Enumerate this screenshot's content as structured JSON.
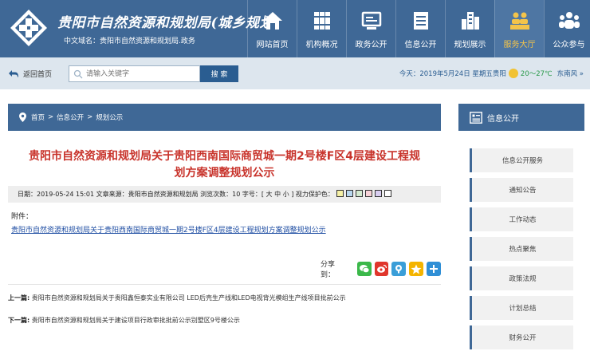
{
  "header": {
    "site_name": "贵阳市自然资源和规划局(城乡规划)",
    "domain_text": "中文域名：贵阳市自然资源和规划局.政务",
    "nav": [
      {
        "label": "网站首页",
        "icon": "home-icon",
        "active": false
      },
      {
        "label": "机构概况",
        "icon": "books-icon",
        "active": false
      },
      {
        "label": "政务公开",
        "icon": "monitor-icon",
        "active": false
      },
      {
        "label": "信息公开",
        "icon": "document-icon",
        "active": false
      },
      {
        "label": "规划展示",
        "icon": "buildings-icon",
        "active": false
      },
      {
        "label": "服务大厅",
        "icon": "people-group-icon",
        "active": true
      },
      {
        "label": "公众参与",
        "icon": "users-icon",
        "active": false
      }
    ],
    "active_color": "#f4c44a",
    "brand_color": "#3f6896"
  },
  "topbar": {
    "home_label": "返回首页",
    "search_placeholder": "请输入关键字",
    "search_button": "搜 索",
    "date_text": "今天：2019年5月24日 星期五贵阳",
    "temperature": "20～27℃",
    "wind": "东南风 »"
  },
  "breadcrumb": {
    "items": [
      "首页",
      "信息公开",
      "规划公示"
    ],
    "separator": ">"
  },
  "article": {
    "title_line1": "贵阳市自然资源和规划局关于贵阳西南国际商贸城一期2号楼F区4层建设工程规",
    "title_line2": "划方案调整规划公示",
    "meta": "日期：2019-05-24 15:01  文章来源：贵阳市自然资源和规划局  浏览次数：10  字号：[ 大 中 小 ]  视力保护色：",
    "eye_colors": [
      "#f6f1a6",
      "#b9d7ee",
      "#d4ead0",
      "#f8d2d8",
      "#d9cef1",
      "#ffffff"
    ],
    "attach_label": "附件：",
    "attach_link": "贵阳市自然资源和规划局关于贵阳西南国际商贸城一期2号楼F区4层建设工程规划方案调整规划公示",
    "share_label": "分享到：",
    "share_icons": [
      "wechat-icon",
      "weibo-icon",
      "tencent-icon",
      "qzone-icon",
      "more-share-icon"
    ],
    "prev_label": "上一篇:",
    "prev_text": "贵阳市自然资源和规划局关于贵阳鑫恒泰实业有限公司 LED后壳生产线和LED电视背光模组生产线项目批前公示",
    "next_label": "下一篇:",
    "next_text": "贵阳市自然资源和规划局关于建设项目行政审批批前公示别墅区9号楼公示"
  },
  "sidebar": {
    "title": "信息公开",
    "items": [
      "信息公开服务",
      "通知公告",
      "工作动态",
      "热点聚焦",
      "政策法规",
      "计划总结",
      "财务公开"
    ]
  }
}
